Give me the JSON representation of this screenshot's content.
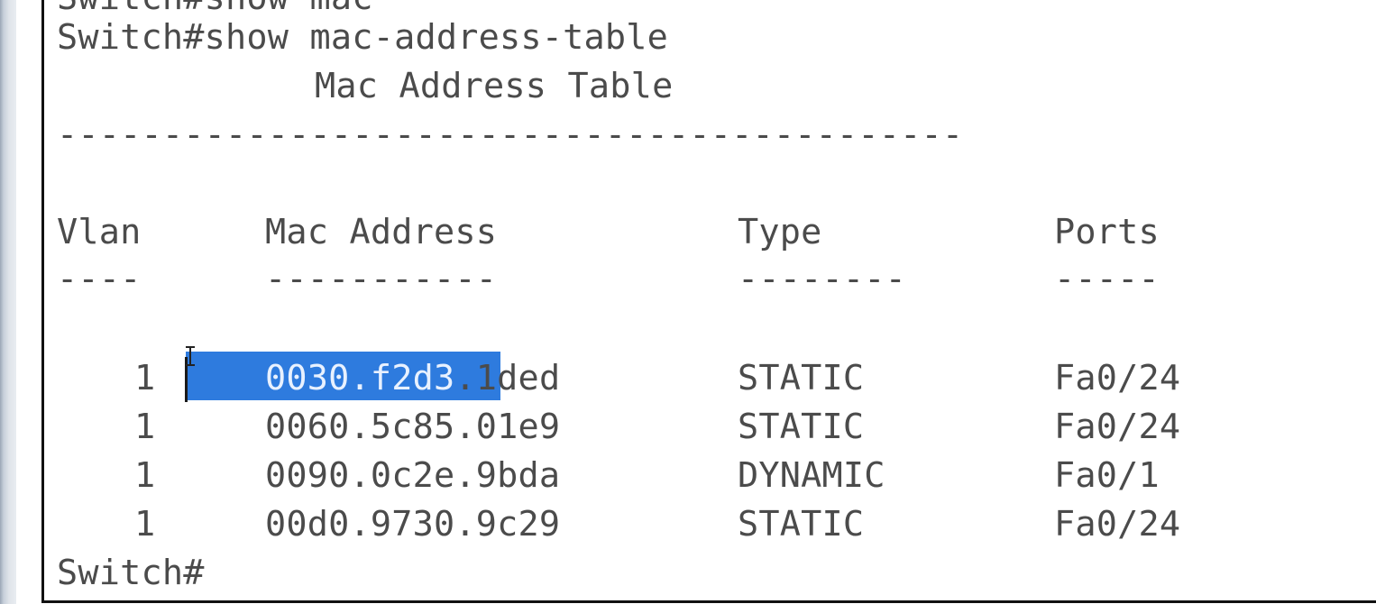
{
  "terminal": {
    "partial_top_line": "Switch#show mac",
    "command_line": "Switch#show mac-address-table",
    "table_title": "Mac Address Table",
    "title_rule": "-------------------------------------------",
    "headers": {
      "vlan": "Vlan",
      "mac": "Mac Address",
      "type": "Type",
      "ports": "Ports"
    },
    "header_rules": {
      "vlan": "----",
      "mac": "-----------",
      "type": "--------",
      "ports": "-----"
    },
    "rows": [
      {
        "vlan": "1",
        "mac_selected": "0030.f2d3",
        "mac_rest": ".1ded",
        "type": "STATIC",
        "ports": "Fa0/24"
      },
      {
        "vlan": "1",
        "mac": "0060.5c85.01e9",
        "type": "STATIC",
        "ports": "Fa0/24"
      },
      {
        "vlan": "1",
        "mac": "0090.0c2e.9bda",
        "type": "DYNAMIC",
        "ports": "Fa0/1"
      },
      {
        "vlan": "1",
        "mac": "00d0.9730.9c29",
        "type": "STATIC",
        "ports": "Fa0/24"
      }
    ],
    "prompt": "Switch#"
  },
  "colors": {
    "text": "#4b4b4b",
    "selection": "#2e7bde",
    "selection_text": "#e8f1ff"
  }
}
